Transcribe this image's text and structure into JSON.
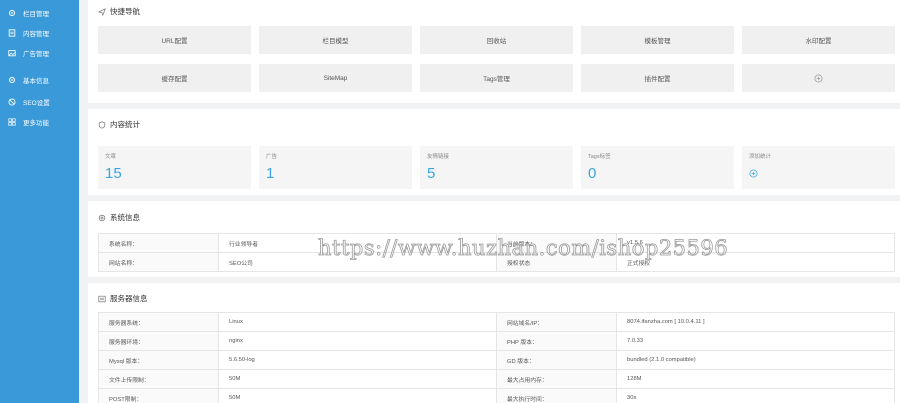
{
  "sidebar": {
    "items": [
      {
        "label": "栏目管理",
        "icon": "gear-icon"
      },
      {
        "label": "内容管理",
        "icon": "document-icon"
      },
      {
        "label": "广告管理",
        "icon": "image-icon"
      },
      {
        "label": "基本信息",
        "icon": "gear-icon"
      },
      {
        "label": "SEO设置",
        "icon": "block-icon"
      },
      {
        "label": "更多功能",
        "icon": "grid-icon"
      }
    ]
  },
  "quick_nav": {
    "title": "快捷导航",
    "buttons": [
      "URL配置",
      "栏目模型",
      "回收站",
      "模板管理",
      "水印配置",
      "缓存配置",
      "SiteMap",
      "Tags管理",
      "插件配置"
    ]
  },
  "content_stats": {
    "title": "内容统计",
    "cards": [
      {
        "label": "文章",
        "value": "15"
      },
      {
        "label": "广告",
        "value": "1"
      },
      {
        "label": "友情链接",
        "value": "5"
      },
      {
        "label": "Tags标签",
        "value": "0"
      },
      {
        "label": "添加统计",
        "value": ""
      }
    ]
  },
  "system_info": {
    "title": "系统信息",
    "rows": [
      [
        "系统名称：",
        "行业领导者",
        "当前版本：",
        "v1.5.6"
      ],
      [
        "网站名称：",
        "SEO公司",
        "授权状态",
        "正式授权"
      ]
    ]
  },
  "server_info": {
    "title": "服务器信息",
    "rows": [
      [
        "服务器系统：",
        "Linux",
        "网站域名/IP：",
        "8074.ifanzha.com [ 10.0.4.11 ]"
      ],
      [
        "服务器环境：",
        "nginx",
        "PHP 版本：",
        "7.0.33"
      ],
      [
        "Mysql 版本：",
        "5.6.50-log",
        "GD 版本：",
        "bundled (2.1.0 compatible)"
      ],
      [
        "文件上传限制：",
        "50M",
        "最大占用内存：",
        "128M"
      ],
      [
        "POST限制：",
        "50M",
        "最大执行时间：",
        "30s"
      ]
    ]
  },
  "watermark": "https://www.huzhan.com/ishop25596",
  "colors": {
    "sidebar": "#3a99d8",
    "accent": "#3aa5e0",
    "background": "#f1f2f4"
  }
}
